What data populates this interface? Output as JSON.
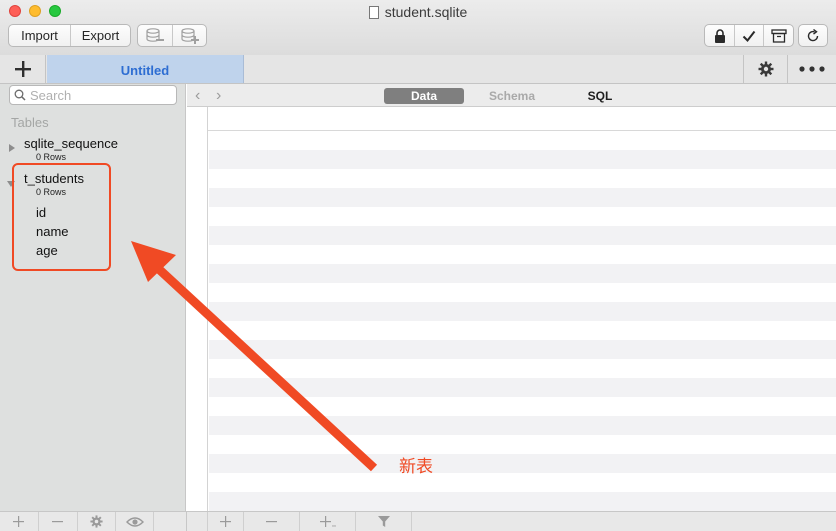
{
  "window": {
    "title": "student.sqlite"
  },
  "toolbar": {
    "import_label": "Import",
    "export_label": "Export"
  },
  "tabs": [
    {
      "label": "Untitled"
    }
  ],
  "search": {
    "placeholder": "Search"
  },
  "sidebar": {
    "section_title": "Tables",
    "tables": [
      {
        "name": "sqlite_sequence",
        "rows": "0 Rows",
        "expanded": false,
        "columns": []
      },
      {
        "name": "t_students",
        "rows": "0 Rows",
        "expanded": true,
        "columns": [
          "id",
          "name",
          "age"
        ]
      }
    ]
  },
  "view_tabs": {
    "data": "Data",
    "schema": "Schema",
    "sql": "SQL",
    "selected": "Data"
  },
  "annotation": {
    "label": "新表",
    "color": "#f04a24"
  },
  "colors": {
    "tab_active_bg": "#bfd3ec",
    "tab_active_text": "#2d6dd2",
    "stripe": "#f2f2f4"
  }
}
